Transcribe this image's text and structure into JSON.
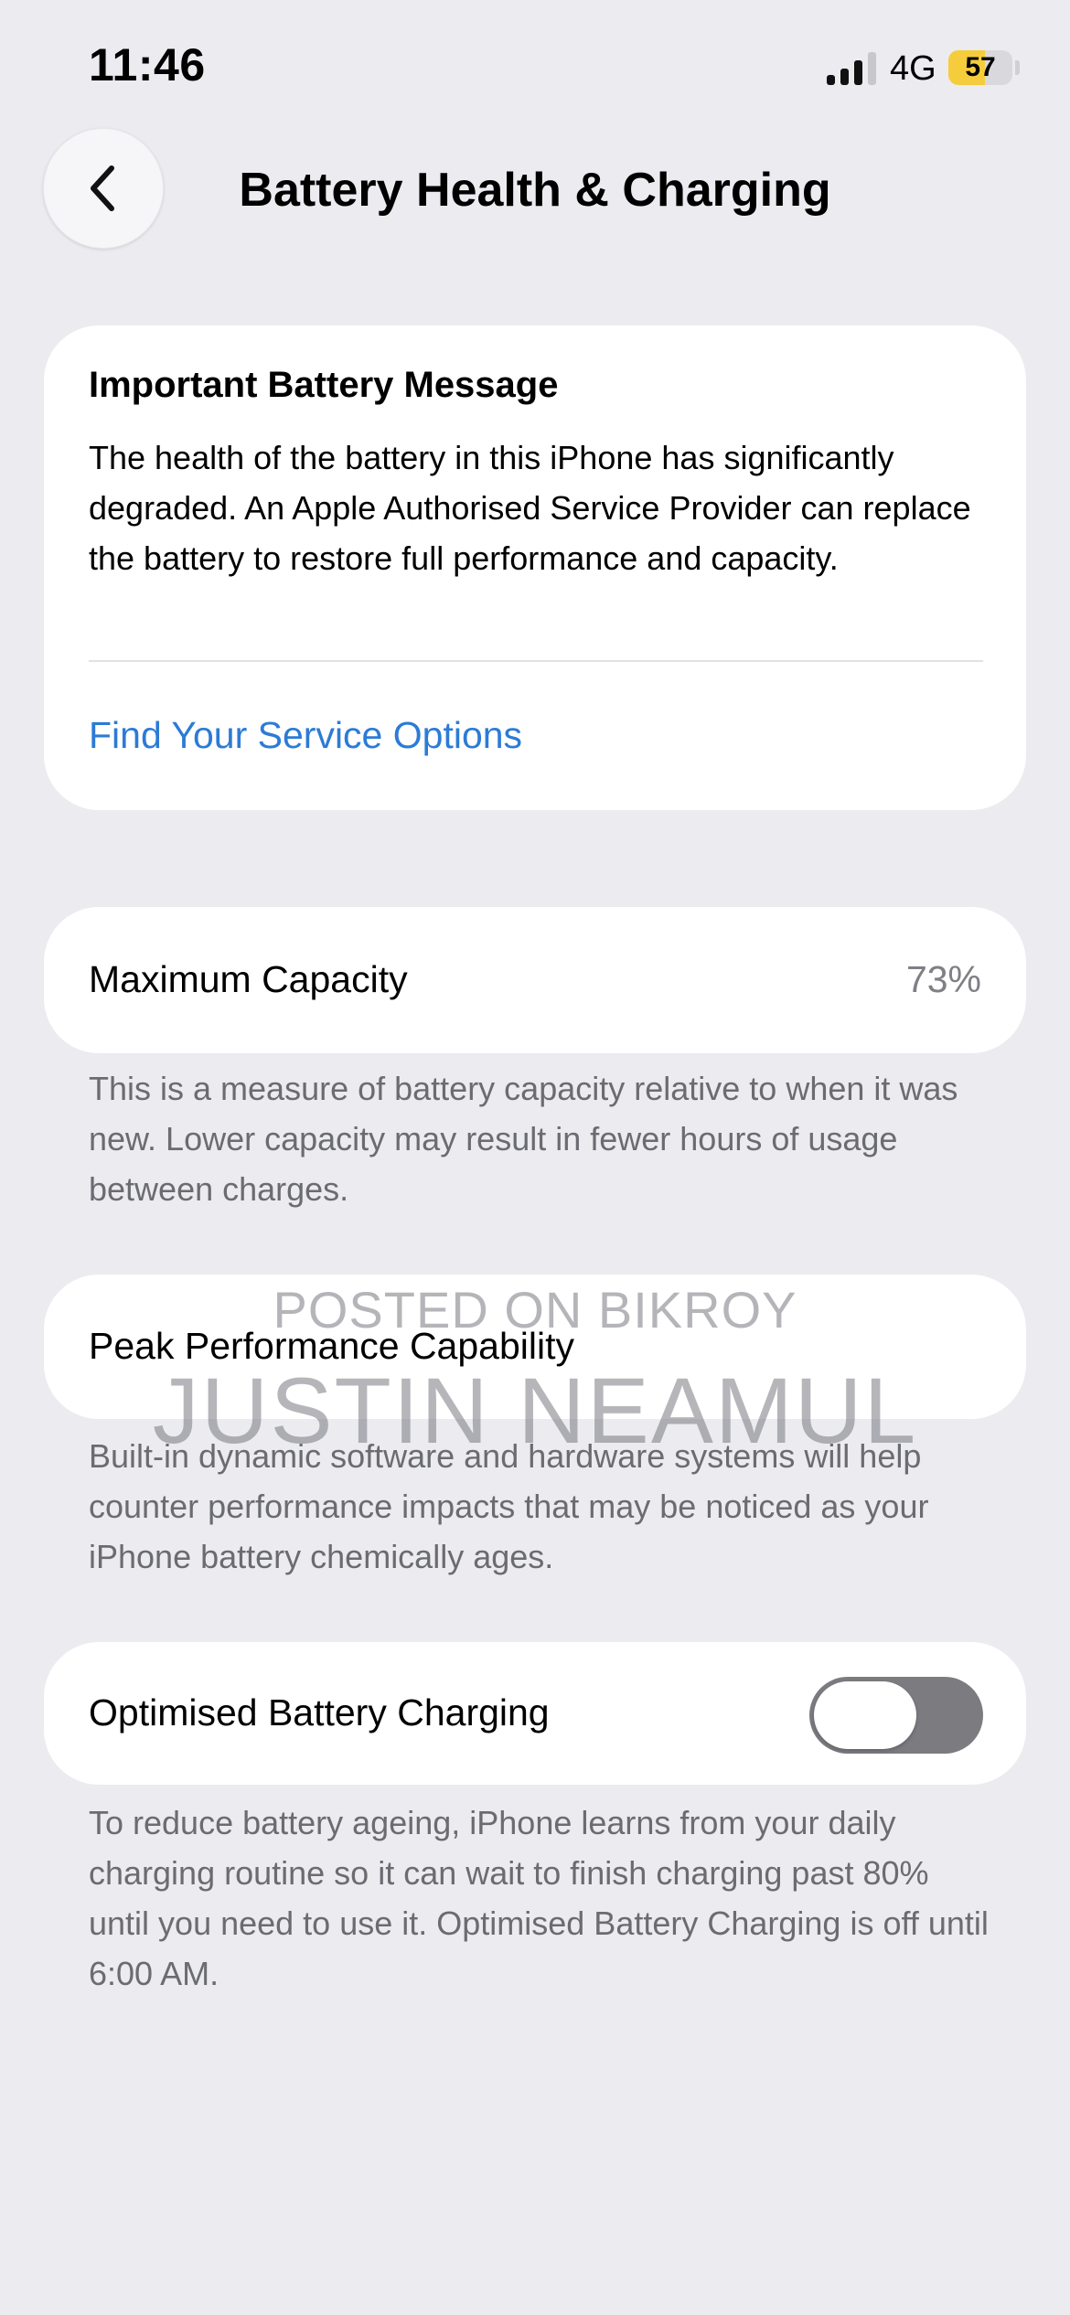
{
  "status_bar": {
    "time": "11:46",
    "network": "4G",
    "signal_bars_active": 3,
    "signal_bars_total": 4,
    "battery_percent": "57",
    "battery_color": "#f5cd3c"
  },
  "nav": {
    "back_icon": "chevron-left-icon",
    "title": "Battery Health & Charging"
  },
  "message_card": {
    "heading": "Important Battery Message",
    "body": "The health of the battery in this iPhone has significantly degraded. An Apple Authorised Service Provider can replace the battery to restore full performance and capacity.",
    "link": "Find Your Service Options",
    "link_color": "#2c7bd6"
  },
  "maximum_capacity": {
    "label": "Maximum Capacity",
    "value": "73%",
    "footnote": "This is a measure of battery capacity relative to when it was new. Lower capacity may result in fewer hours of usage between charges."
  },
  "peak_performance": {
    "label": "Peak Performance Capability",
    "footnote": "Built-in dynamic software and hardware systems will help counter performance impacts that may be noticed as your iPhone battery chemically ages."
  },
  "optimised_charging": {
    "label": "Optimised Battery Charging",
    "toggle_on": false,
    "footnote": "To reduce battery ageing, iPhone learns from your daily charging routine so it can wait to finish charging past 80% until you need to use it. Optimised Battery Charging is off until 6:00 AM."
  },
  "watermark": {
    "line1": "POSTED ON BIKROY",
    "line2": "JUSTIN NEAMUL"
  }
}
